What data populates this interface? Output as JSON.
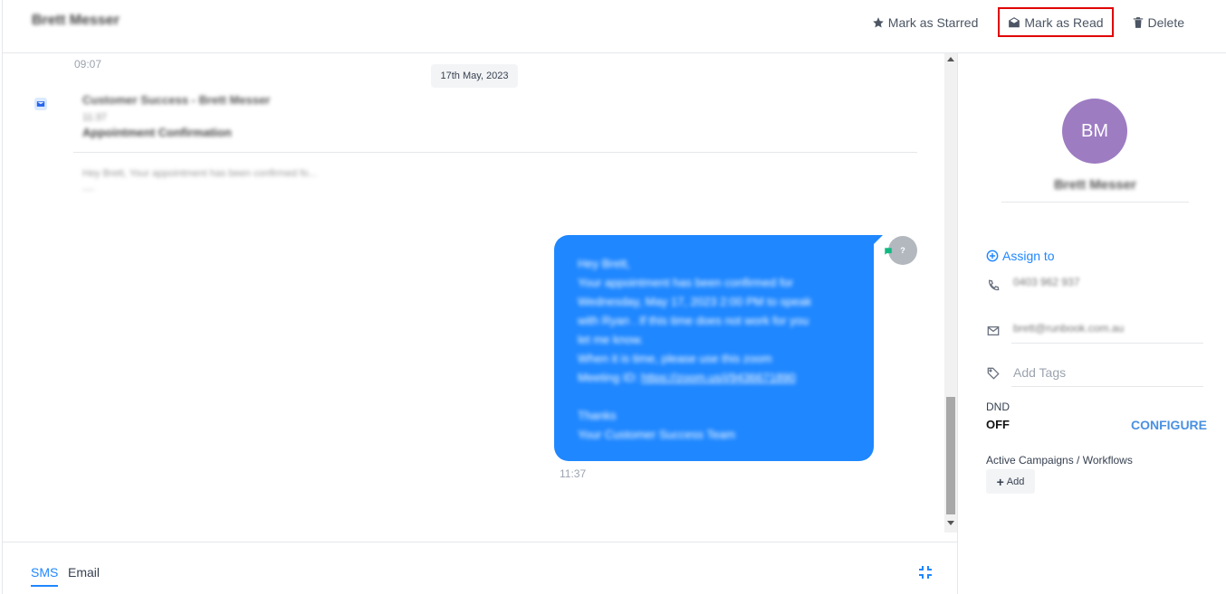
{
  "header": {
    "contact_name": "Brett Messer",
    "actions": {
      "starred_label": "Mark as Starred",
      "read_label": "Mark as Read",
      "delete_label": "Delete"
    }
  },
  "conversation": {
    "top_time": "09:07",
    "date_separator": "17th May, 2023",
    "email_card": {
      "from": "Customer Success - Brett Messer",
      "time": "11:37",
      "subject": "Appointment Confirmation",
      "preview": "Hey Brett, Your appointment has been confirmed fo...",
      "more": "----"
    },
    "message": {
      "lines": [
        "Hey Brett,",
        "Your appointment has been confirmed for",
        "Wednesday, May 17, 2023 2:00 PM to speak",
        "with Ryan . If this time does not work for you",
        "let me know.",
        "When it is time, please use this zoom",
        "Meeting ID:"
      ],
      "link": "https://zoom.us/j/9436671890",
      "closing": [
        "Thanks",
        "Your Customer Success Team"
      ],
      "time": "11:37",
      "sender_avatar": "?"
    }
  },
  "composer": {
    "tabs": [
      "SMS",
      "Email"
    ],
    "active_tab": "SMS"
  },
  "contact_panel": {
    "initials": "BM",
    "name": "Brett Messer",
    "assign_label": "Assign to",
    "phone": "0403 962 937",
    "email": "brett@runbook.com.au",
    "tags_placeholder": "Add Tags",
    "dnd_label": "DND",
    "dnd_value": "OFF",
    "configure_label": "CONFIGURE",
    "campaigns_label": "Active Campaigns / Workflows",
    "add_label": "Add"
  },
  "colors": {
    "accent": "#1f87ff",
    "avatar_bg": "#9d7cc2",
    "highlight_border": "#e00000"
  }
}
